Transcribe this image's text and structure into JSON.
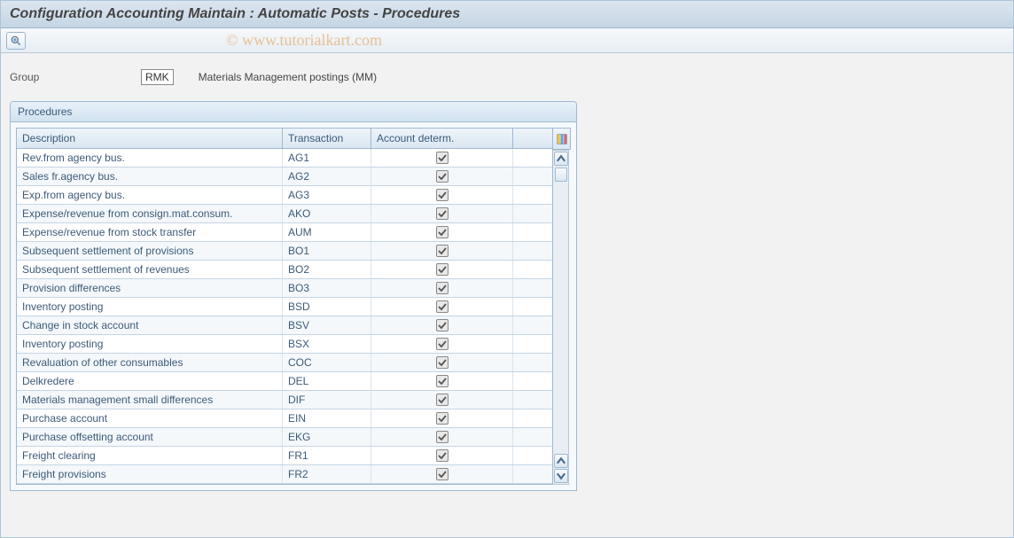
{
  "title": "Configuration Accounting Maintain : Automatic Posts - Procedures",
  "watermark": "© www.tutorialkart.com",
  "group": {
    "label": "Group",
    "value": "RMK",
    "description": "Materials Management postings (MM)"
  },
  "panel": {
    "title": "Procedures",
    "columns": {
      "description": "Description",
      "transaction": "Transaction",
      "account_determ": "Account determ."
    },
    "rows": [
      {
        "desc": "Rev.from agency bus.",
        "txn": "AG1",
        "acct": true,
        "highlight": true
      },
      {
        "desc": "Sales fr.agency bus.",
        "txn": "AG2",
        "acct": true
      },
      {
        "desc": "Exp.from agency bus.",
        "txn": "AG3",
        "acct": true
      },
      {
        "desc": "Expense/revenue from consign.mat.consum.",
        "txn": "AKO",
        "acct": true
      },
      {
        "desc": "Expense/revenue from stock transfer",
        "txn": "AUM",
        "acct": true
      },
      {
        "desc": "Subsequent settlement of provisions",
        "txn": "BO1",
        "acct": true
      },
      {
        "desc": "Subsequent settlement of revenues",
        "txn": "BO2",
        "acct": true
      },
      {
        "desc": "Provision differences",
        "txn": "BO3",
        "acct": true
      },
      {
        "desc": "Inventory posting",
        "txn": "BSD",
        "acct": true
      },
      {
        "desc": "Change in stock account",
        "txn": "BSV",
        "acct": true
      },
      {
        "desc": "Inventory posting",
        "txn": "BSX",
        "acct": true
      },
      {
        "desc": "Revaluation of other consumables",
        "txn": "COC",
        "acct": true
      },
      {
        "desc": "Delkredere",
        "txn": "DEL",
        "acct": true
      },
      {
        "desc": "Materials management small differences",
        "txn": "DIF",
        "acct": true
      },
      {
        "desc": "Purchase account",
        "txn": "EIN",
        "acct": true
      },
      {
        "desc": "Purchase offsetting account",
        "txn": "EKG",
        "acct": true
      },
      {
        "desc": "Freight clearing",
        "txn": "FR1",
        "acct": true
      },
      {
        "desc": "Freight provisions",
        "txn": "FR2",
        "acct": true
      }
    ]
  }
}
